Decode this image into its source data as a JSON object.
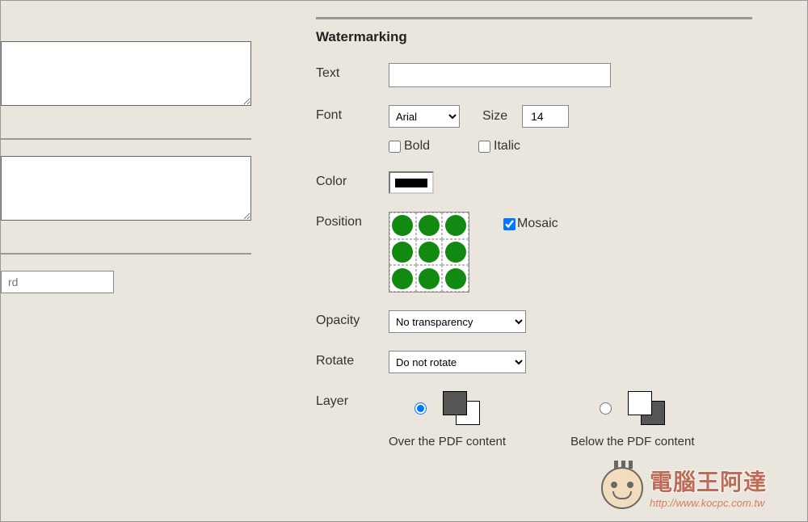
{
  "section_title": "Watermarking",
  "labels": {
    "text": "Text",
    "font": "Font",
    "size": "Size",
    "bold": "Bold",
    "italic": "Italic",
    "color": "Color",
    "position": "Position",
    "mosaic": "Mosaic",
    "opacity": "Opacity",
    "rotate": "Rotate",
    "layer": "Layer",
    "over": "Over the PDF content",
    "below": "Below the PDF content"
  },
  "values": {
    "text": "",
    "font": "Arial",
    "size": "14",
    "bold": false,
    "italic": false,
    "color": "#000000",
    "mosaic": true,
    "opacity": "No transparency",
    "rotate": "Do not rotate",
    "layer": "over"
  },
  "left": {
    "password_placeholder": "rd"
  },
  "overlay": {
    "title": "電腦王阿達",
    "url": "http://www.kocpc.com.tw"
  }
}
